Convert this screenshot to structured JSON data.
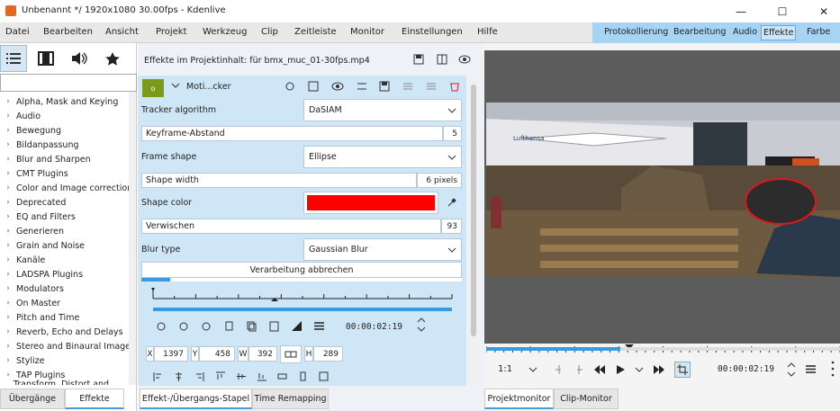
{
  "window": {
    "title": "Unbenannt */ 1920x1080 30.00fps - Kdenlive",
    "minimize": "—",
    "maximize": "☐",
    "close": "✕"
  },
  "menu": [
    "Datei",
    "Bearbeiten",
    "Ansicht",
    "Projekt",
    "Werkzeug",
    "Clip",
    "Zeitleiste",
    "Monitor",
    "Einstellungen",
    "Hilfe"
  ],
  "workspaces": [
    "Protokollierung",
    "Bearbeitung",
    "Audio",
    "Effekte",
    "Farbe"
  ],
  "workspace_active": "Effekte",
  "left": {
    "categories": [
      "Alpha, Mask and Keying",
      "Audio",
      "Bewegung",
      "Bildanpassung",
      "Blur and Sharpen",
      "CMT Plugins",
      "Color and Image correction",
      "Deprecated",
      "EQ and Filters",
      "Generieren",
      "Grain and Noise",
      "Kanäle",
      "LADSPA Plugins",
      "Modulators",
      "On Master",
      "Pitch and Time",
      "Reverb, Echo and Delays",
      "Stereo and Binaural Images",
      "Stylize",
      "TAP Plugins",
      "Transform, Distort and Perspective"
    ],
    "tabs": [
      "Übergänge",
      "Effekte"
    ]
  },
  "center": {
    "header": "Effekte im Projektinhalt: für bmx_muc_01-30fps.mp4",
    "effect_badge": "o",
    "effect_name": "Moti...cker",
    "tracker_label": "Tracker algorithm",
    "tracker_value": "DaSIAM",
    "keyframe_label": "Keyframe-Abstand",
    "keyframe_value": "5",
    "frame_shape_label": "Frame shape",
    "frame_shape_value": "Ellipse",
    "shape_width_label": "Shape width",
    "shape_width_value": "6 pixels",
    "shape_color_label": "Shape color",
    "shape_color": "#ff0000",
    "blur_label": "Verwischen",
    "blur_value": "93",
    "blur_type_label": "Blur type",
    "blur_type_value": "Gaussian Blur",
    "cancel_label": "Verarbeitung abbrechen",
    "timecode": "00:00:02:19",
    "x_label": "X",
    "x_value": "1397",
    "y_label": "Y",
    "y_value": "458",
    "w_label": "W",
    "w_value": "392",
    "h_label": "H",
    "h_value": "289",
    "tabs": [
      "Effekt-/Übergangs-Stapel",
      "Time Remapping"
    ]
  },
  "monitor": {
    "zoom": "1:1",
    "timecode": "00:00:02:19",
    "tabs": [
      "Projektmonitor",
      "Clip-Monitor"
    ],
    "billboard": "Lufthansa"
  }
}
